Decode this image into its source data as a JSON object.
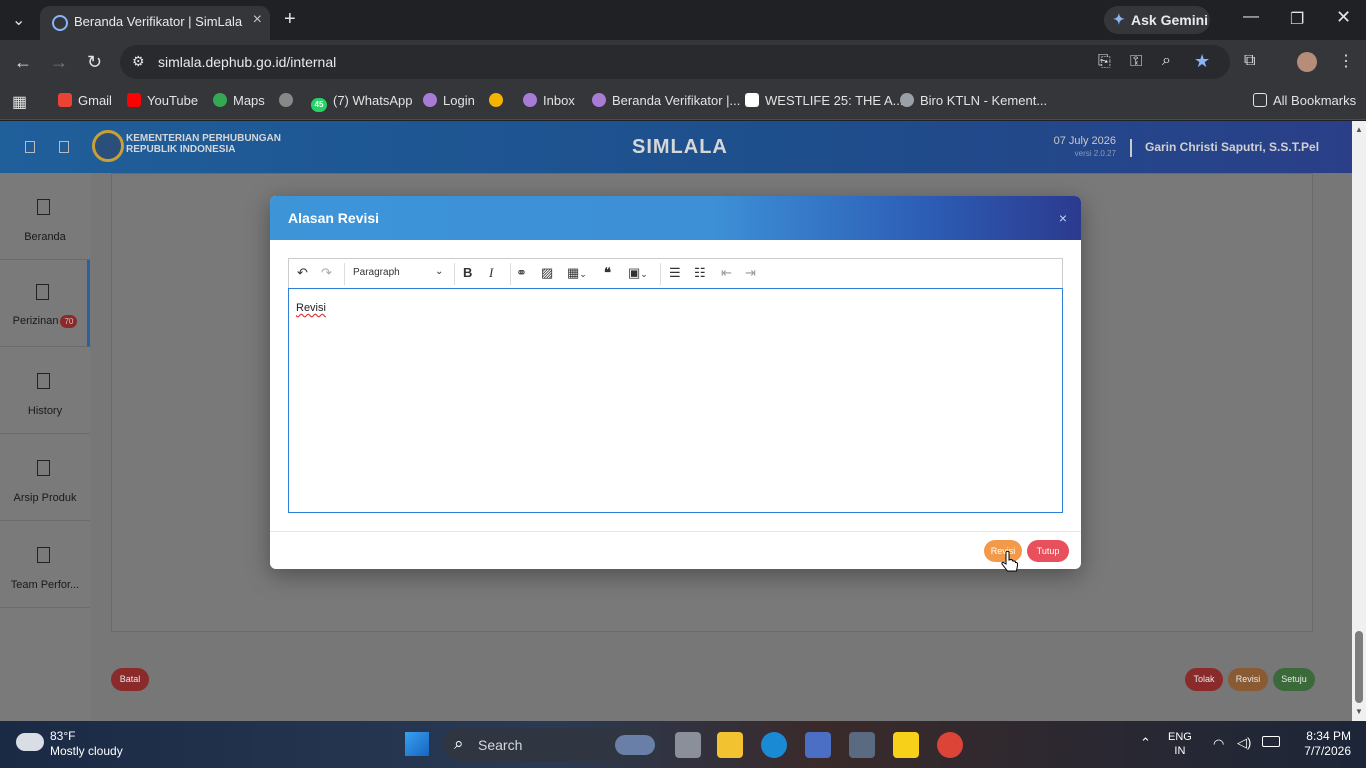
{
  "browser": {
    "tab_title": "Beranda Verifikator | SimLala",
    "gemini_label": "Ask Gemini",
    "url": "simlala.dephub.go.id/internal",
    "bookmarks": [
      "Gmail",
      "YouTube",
      "Maps",
      "(7) WhatsApp",
      "Login",
      "Inbox",
      "Beranda Verifikator |...",
      "WESTLIFE 25: THE A...",
      "Biro KTLN - Kement..."
    ],
    "whatsapp_count": "45",
    "all_bookmarks": "All Bookmarks"
  },
  "header": {
    "org_line1": "KEMENTERIAN PERHUBUNGAN",
    "org_line2": "REPUBLIK INDONESIA",
    "app_name": "SIMLALA",
    "date": "07 July 2026",
    "version": "versi 2.0.27",
    "user": "Garin Christi Saputri, S.S.T.Pel"
  },
  "sidebar": {
    "items": [
      {
        "label": "Beranda"
      },
      {
        "label": "Perizinan",
        "badge": "70"
      },
      {
        "label": "History"
      },
      {
        "label": "Arsip Produk"
      },
      {
        "label": "Team Perfor..."
      }
    ]
  },
  "page_buttons": {
    "batal": "Batal",
    "tolak": "Tolak",
    "revisi": "Revisi",
    "setuju": "Setuju"
  },
  "modal": {
    "title": "Alasan Revisi",
    "close": "×",
    "heading_select": "Paragraph",
    "editor_text": "Revisi",
    "revisi_button": "Revisi",
    "tutup_button": "Tutup"
  },
  "taskbar": {
    "temperature": "83°F",
    "weather": "Mostly cloudy",
    "search_placeholder": "Search",
    "lang1": "ENG",
    "lang2": "IN",
    "time": "8:34 PM",
    "date": "7/7/2026"
  },
  "colors": {
    "modal_header_start": "#3d95d8",
    "modal_header_end": "#2b3a8e",
    "revisi_orange": "#f39a4a",
    "tutup_red": "#e8505b",
    "setuju_green": "#3a7a3a"
  }
}
